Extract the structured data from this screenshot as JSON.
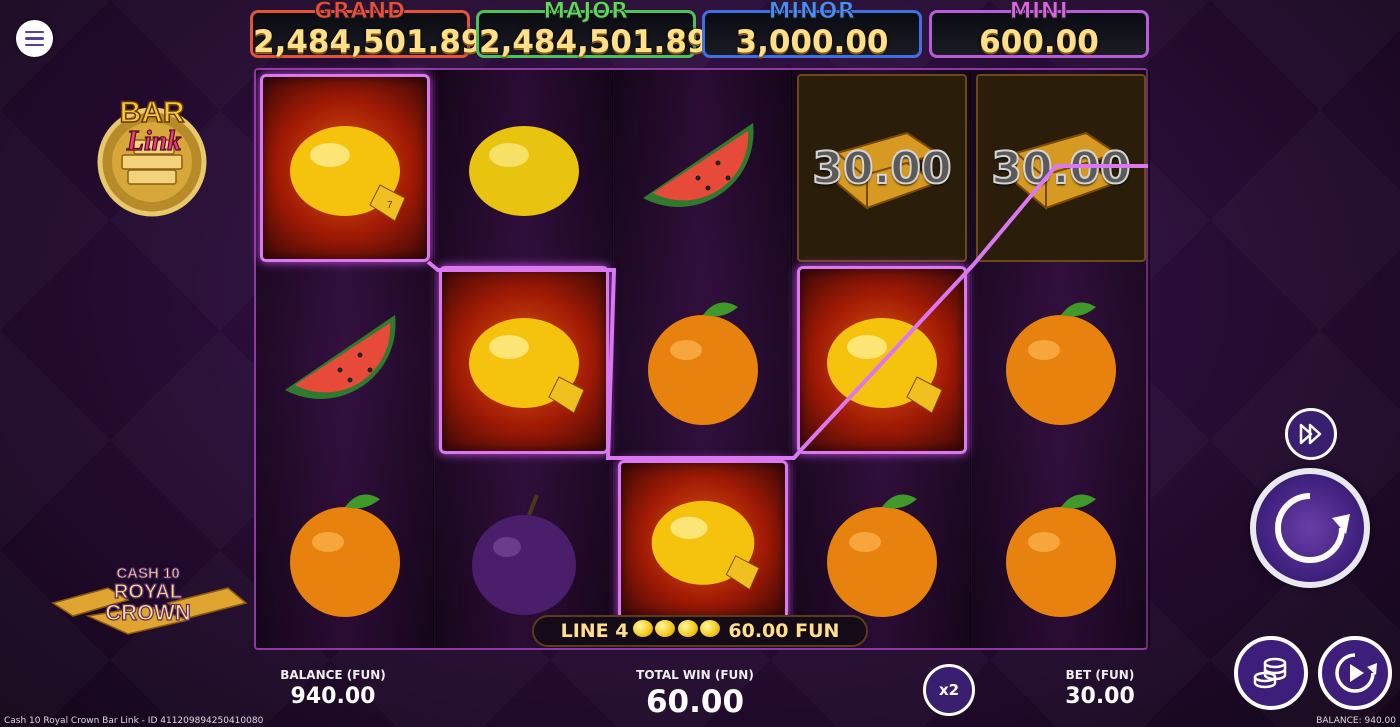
{
  "jackpots": {
    "grand": {
      "name": "GRAND",
      "value": "2,484,501.89"
    },
    "major": {
      "name": "MAJOR",
      "value": "2,484,501.89"
    },
    "minor": {
      "name": "MINOR",
      "value": "3,000.00"
    },
    "mini": {
      "name": "MINI",
      "value": "600.00"
    }
  },
  "logos": {
    "bar_link": {
      "line1": "BAR",
      "line2": "Link"
    },
    "cash": {
      "line1": "CASH 10",
      "line2": "ROYAL",
      "line3": "CROWN"
    }
  },
  "reels": [
    [
      "lemon-hl",
      "watermelon",
      "orange"
    ],
    [
      "lemon",
      "lemon-hl",
      "plum"
    ],
    [
      "watermelon",
      "orange",
      "lemon-hl"
    ],
    [
      "gold-bar",
      "lemon-hl",
      "orange"
    ],
    [
      "gold-bar",
      "orange",
      "orange"
    ]
  ],
  "gold_values": {
    "reel4": "30.00",
    "reel5": "30.00"
  },
  "line_win": {
    "line": "LINE 4",
    "amount": "60.00 FUN",
    "symbol_count": 4
  },
  "bottom": {
    "balance_label": "BALANCE (FUN)",
    "balance": "940.00",
    "total_win_label": "TOTAL WIN (FUN)",
    "total_win": "60.00",
    "bet_label": "BET (FUN)",
    "bet": "30.00",
    "multiplier_label": "x2"
  },
  "footer": {
    "left": "Cash 10 Royal Crown Bar Link - ID 411209894250410080",
    "right": "BALANCE: 940.00"
  },
  "colors": {
    "grand": "#ef4a3c",
    "major": "#5fd95a",
    "minor": "#4a8cff",
    "mini": "#e061e8",
    "highlight": "#d978f0"
  }
}
